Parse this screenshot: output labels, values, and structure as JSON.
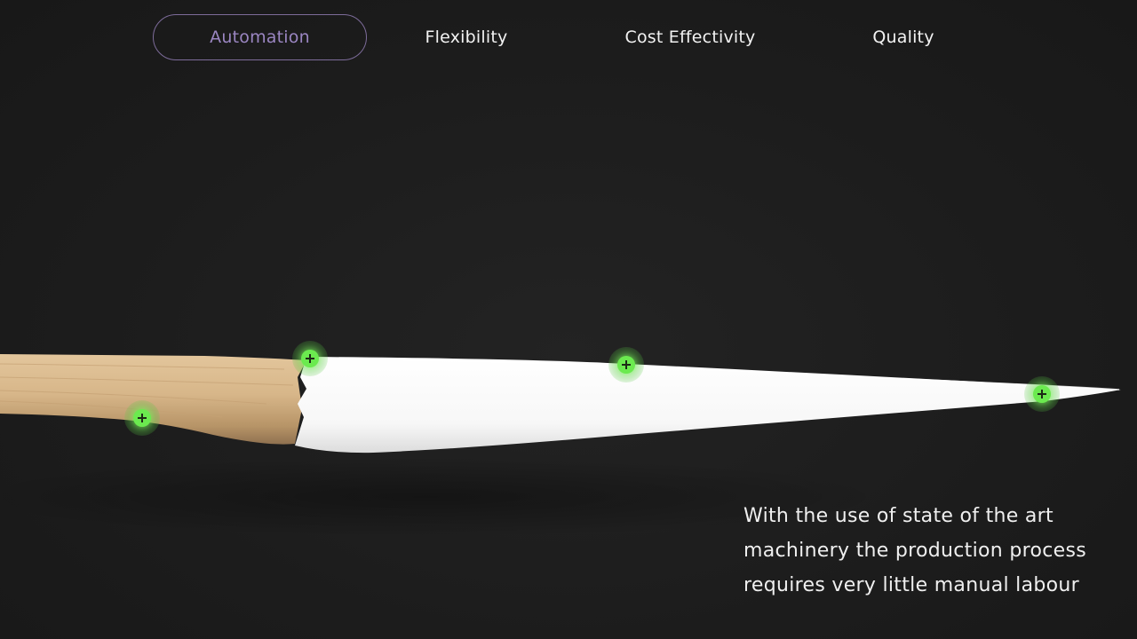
{
  "tabs": [
    {
      "label": "Automation",
      "active": true
    },
    {
      "label": "Flexibility",
      "active": false
    },
    {
      "label": "Cost Effectivity",
      "active": false
    },
    {
      "label": "Quality",
      "active": false
    }
  ],
  "colors": {
    "background": "#1e1e1e",
    "active_tab": "#9b86c2",
    "hotspot": "#6bea4f",
    "wood": "#d8b98c",
    "blade_coating": "#ffffff"
  },
  "hotspot_icon": "plus-icon",
  "description": {
    "text": "With the use of state of the art machinery the production process requires very little manual labour"
  }
}
